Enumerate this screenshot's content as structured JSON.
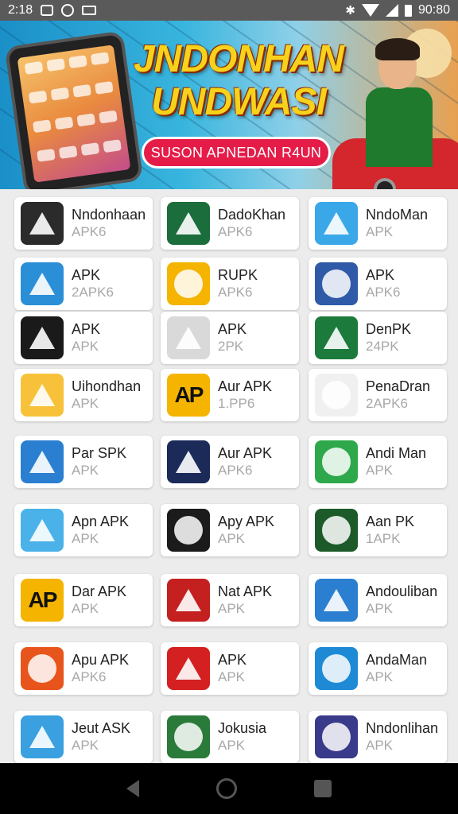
{
  "status_bar": {
    "time": "2:18",
    "battery": "90:80"
  },
  "banner": {
    "title_line1": "JNDONHAN",
    "title_line2": "UNDWASI",
    "button_label": "SUSON APNEDAN R4UN"
  },
  "apps": [
    {
      "name": "Nndonhaan",
      "sub": "APK6",
      "color": "#2b2b2b",
      "icon": "triangle"
    },
    {
      "name": "DadoKhan",
      "sub": "APK6",
      "color": "#1b6d3b",
      "icon": "triangle"
    },
    {
      "name": "NndoMan",
      "sub": "APK",
      "color": "#3aa8e8",
      "icon": "triangle"
    },
    {
      "name": "APK",
      "sub": "2APK6",
      "color": "#2b8fd8",
      "icon": "triangle"
    },
    {
      "name": "RUPK",
      "sub": "APK6",
      "color": "#f5b400",
      "icon": "circle"
    },
    {
      "name": "APK",
      "sub": "APK6",
      "color": "#2f5aa8",
      "icon": "circle"
    },
    {
      "name": "APK",
      "sub": "APK",
      "color": "#1a1a1a",
      "icon": "triangle"
    },
    {
      "name": "APK",
      "sub": "2PK",
      "color": "#d9d9d9",
      "icon": "triangle"
    },
    {
      "name": "DenPK",
      "sub": "24PK",
      "color": "#1c7a3d",
      "icon": "triangle"
    },
    {
      "name": "Uihondhan",
      "sub": "APK",
      "color": "#f7c23a",
      "icon": "triangle"
    },
    {
      "name": "Aur APK",
      "sub": "1.PP6",
      "color": "#f5b400",
      "icon": "ap"
    },
    {
      "name": "PenaDran",
      "sub": "2APK6",
      "color": "#f0f0f0",
      "icon": "circle"
    },
    {
      "name": "Par SPK",
      "sub": "APK",
      "color": "#2a7fd0",
      "icon": "triangle"
    },
    {
      "name": "Aur APK",
      "sub": "APK6",
      "color": "#1c2a5a",
      "icon": "triangle"
    },
    {
      "name": "Andi Man",
      "sub": "APK",
      "color": "#2ea84a",
      "icon": "circle"
    },
    {
      "name": "Apn APK",
      "sub": "APK",
      "color": "#4ab2e8",
      "icon": "triangle"
    },
    {
      "name": "Apy APK",
      "sub": "APK",
      "color": "#1b1b1b",
      "icon": "circle"
    },
    {
      "name": "Aan PK",
      "sub": "1APK",
      "color": "#1d5a2a",
      "icon": "circle"
    },
    {
      "name": "Dar APK",
      "sub": "APK",
      "color": "#f5b400",
      "icon": "ap"
    },
    {
      "name": "Nat APK",
      "sub": "APK",
      "color": "#c42020",
      "icon": "triangle"
    },
    {
      "name": "Andouliban",
      "sub": "APK",
      "color": "#2a7fd0",
      "icon": "triangle"
    },
    {
      "name": "Apu APK",
      "sub": "APK6",
      "color": "#e8551c",
      "icon": "circle"
    },
    {
      "name": "APK",
      "sub": "APK",
      "color": "#d42020",
      "icon": "triangle"
    },
    {
      "name": "AndaMan",
      "sub": "APK",
      "color": "#1e8ad6",
      "icon": "circle"
    },
    {
      "name": "Jeut ASK",
      "sub": "APK",
      "color": "#3aa0e0",
      "icon": "triangle"
    },
    {
      "name": "Jokusia",
      "sub": "APK",
      "color": "#2a7a3a",
      "icon": "circle"
    },
    {
      "name": "Nndonlihan",
      "sub": "APK",
      "color": "#3a3a8a",
      "icon": "circle"
    }
  ]
}
